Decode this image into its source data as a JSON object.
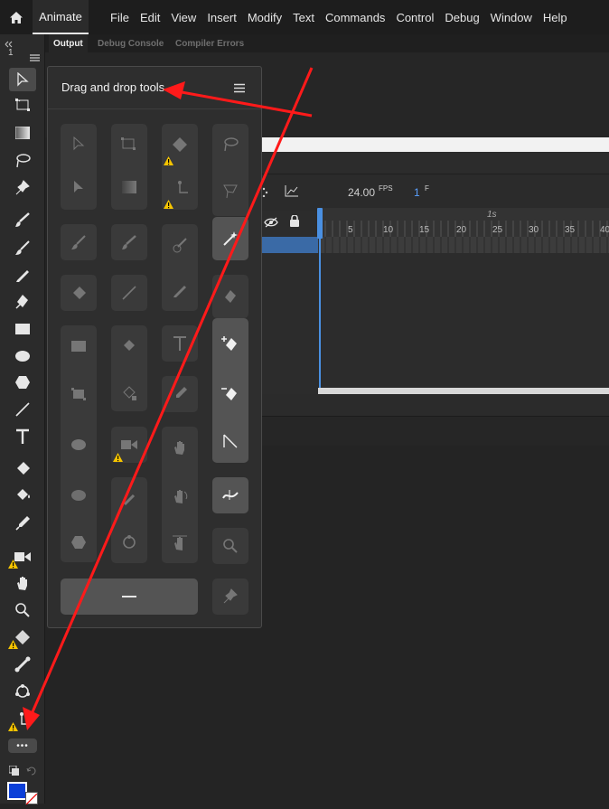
{
  "menubar": {
    "app_tab": "Animate",
    "items": [
      "File",
      "Edit",
      "View",
      "Insert",
      "Modify",
      "Text",
      "Commands",
      "Control",
      "Debug",
      "Window",
      "Help"
    ]
  },
  "toolbar": {
    "counter": "1",
    "more_label": "•••"
  },
  "panel_tabs": [
    "Output",
    "Debug Console",
    "Compiler Errors"
  ],
  "drag_drop_panel": {
    "title": "Drag and drop tools"
  },
  "timeline": {
    "fps_value": "24.00",
    "fps_unit": "FPS",
    "frame_value": "1",
    "frame_unit": "F",
    "seconds_marker": "1s",
    "ruler_numbers": [
      "5",
      "10",
      "15",
      "20",
      "25",
      "30",
      "35",
      "40"
    ]
  },
  "colors": {
    "accent": "#4a90e2",
    "arrow": "#ff1a1a",
    "stroke_color": "#0b3fd8",
    "warning": "#f5c400"
  }
}
